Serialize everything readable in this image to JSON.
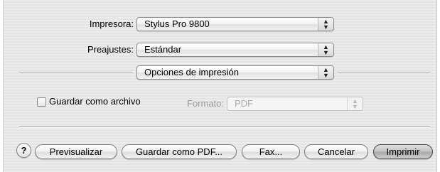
{
  "printer": {
    "label": "Impresora:",
    "value": "Stylus Pro 9800"
  },
  "presets": {
    "label": "Preajustes:",
    "value": "Estándar"
  },
  "section_menu": {
    "value": "Opciones de impresión"
  },
  "save_as_file": {
    "label": "Guardar como archivo",
    "checked": false
  },
  "format": {
    "label": "Formato:",
    "value": "PDF"
  },
  "buttons": {
    "help": "?",
    "preview": "Previsualizar",
    "save_pdf": "Guardar como PDF...",
    "fax": "Fax...",
    "cancel": "Cancelar",
    "print": "Imprimir"
  }
}
